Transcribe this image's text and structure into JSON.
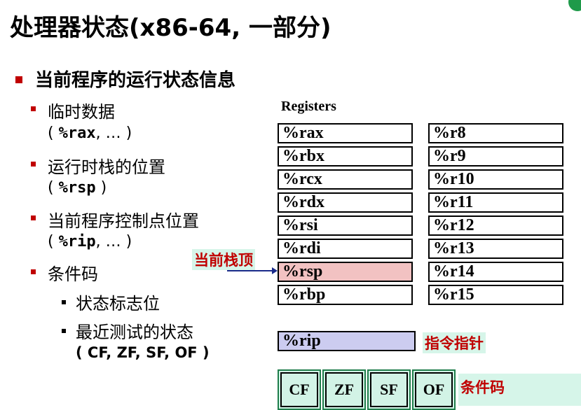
{
  "title": "处理器状态(x86-64, 一部分)",
  "main_bullet": "当前程序的运行状态信息",
  "sub_items": [
    {
      "label": "临时数据",
      "paren_open": "(",
      "code": "%rax",
      "rest": ", …",
      "paren_close": ")"
    },
    {
      "label": "运行时栈的位置",
      "paren_open": "(",
      "code": "%rsp",
      "rest": "",
      "paren_close": ")"
    },
    {
      "label": "当前程序控制点位置",
      "paren_open": "(",
      "code": "%rip",
      "rest": ", …",
      "paren_close": ")"
    },
    {
      "label": "条件码"
    }
  ],
  "cc_items": [
    {
      "label": "状态标志位"
    },
    {
      "label": "最近测试的状态",
      "paren": "( CF, ZF, SF, OF )"
    }
  ],
  "registers": {
    "label": "Registers",
    "left": [
      "%rax",
      "%rbx",
      "%rcx",
      "%rdx",
      "%rsi",
      "%rdi",
      "%rsp",
      "%rbp"
    ],
    "right": [
      "%r8",
      "%r9",
      "%r10",
      "%r11",
      "%r12",
      "%r13",
      "%r14",
      "%r15"
    ],
    "highlight": "%rsp",
    "highlight_color": "#f2c2c2"
  },
  "rip": {
    "name": "%rip",
    "color": "#ccccf0"
  },
  "flags": [
    "CF",
    "ZF",
    "SF",
    "OF"
  ],
  "callouts": {
    "stack_top": "当前栈顶",
    "instruction_pointer": "指令指针",
    "condition_codes": "条件码"
  },
  "colors": {
    "bullet": "#c00000",
    "callout_text": "#c00000",
    "callout_bg": "#d6f5e9",
    "arrow": "#1a2a8a"
  }
}
